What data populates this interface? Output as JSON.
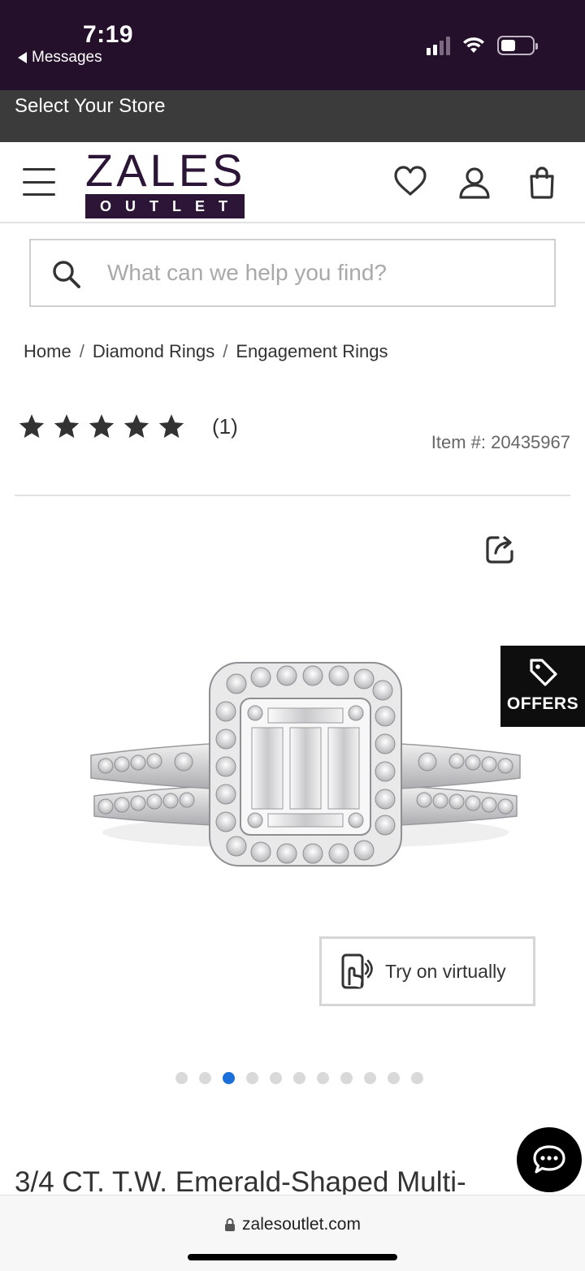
{
  "status_bar": {
    "time": "7:19",
    "back_label": "Messages"
  },
  "store_bar": {
    "label": "Select Your Store"
  },
  "header": {
    "logo_top": "ZALES",
    "logo_bottom": "OUTLET",
    "icons": [
      "menu-icon",
      "heart-icon",
      "user-icon",
      "bag-icon"
    ]
  },
  "search": {
    "placeholder": "What can we help you find?",
    "value": ""
  },
  "breadcrumb": {
    "items": [
      "Home",
      "Diamond Rings",
      "Engagement Rings"
    ],
    "separator": "/"
  },
  "product": {
    "rating": 5,
    "review_count": "(1)",
    "item_number": "Item #: 20435967",
    "title": "3/4 CT. T.W. Emerald-Shaped Multi-"
  },
  "offers": {
    "label": "OFFERS"
  },
  "try_on": {
    "label": "Try on virtually"
  },
  "carousel": {
    "total": 11,
    "active_index": 2
  },
  "safari": {
    "url": "zalesoutlet.com"
  },
  "colors": {
    "brand": "#2c1536",
    "active_dot": "#1a6fd8",
    "status_bg": "#24102a"
  }
}
